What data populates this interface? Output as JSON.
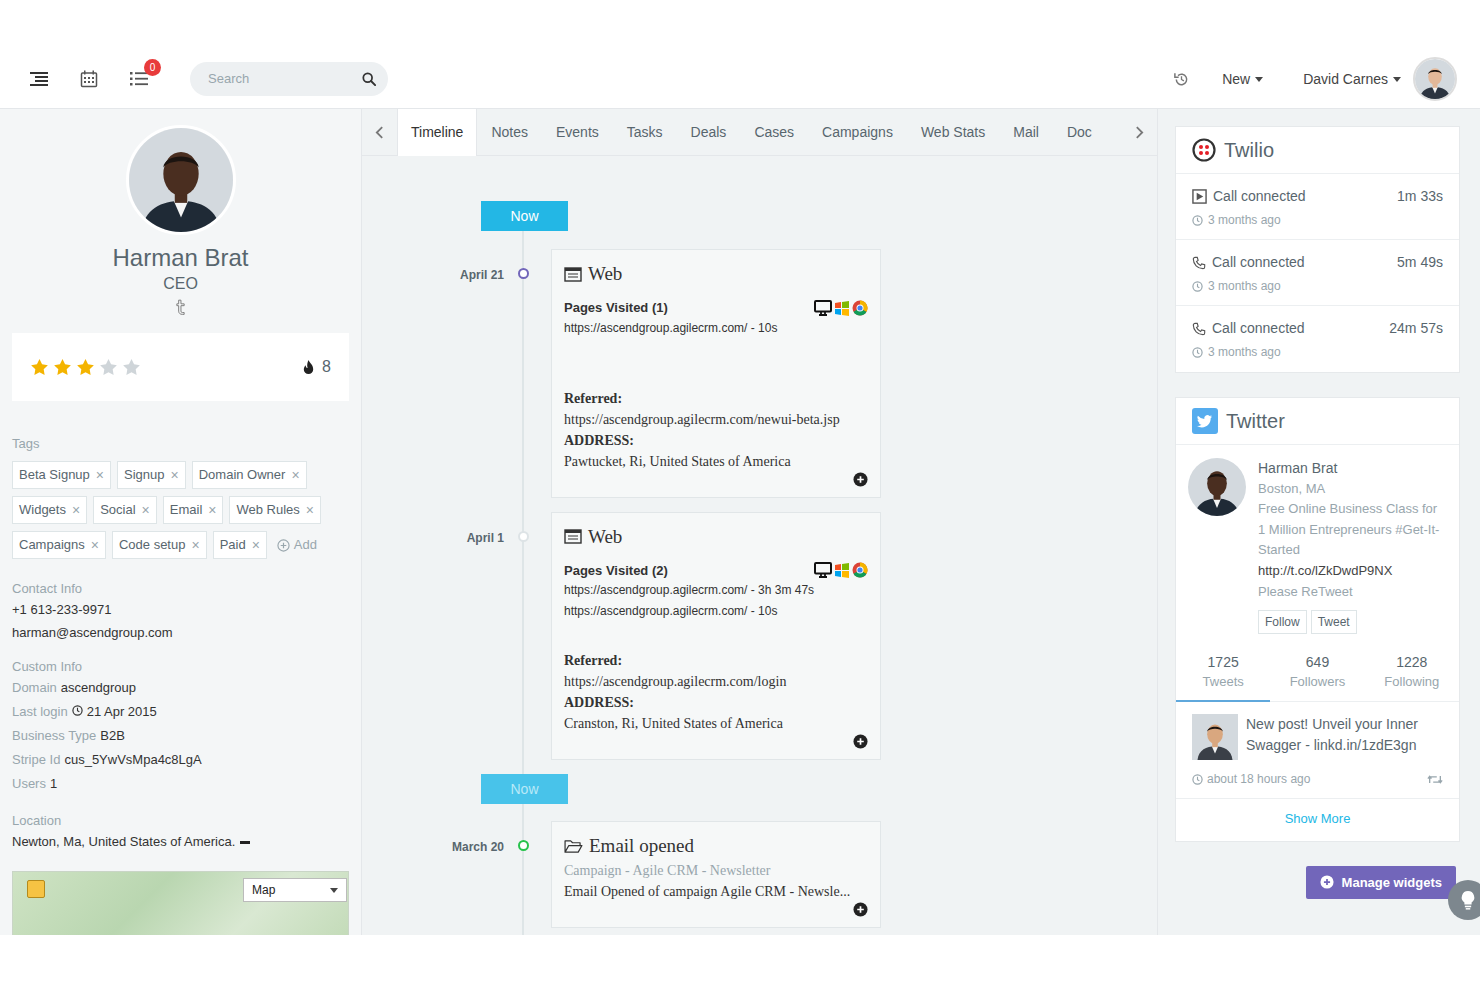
{
  "header": {
    "badge": "0",
    "search_placeholder": "Search",
    "new_label": "New",
    "user_name": "David Carnes"
  },
  "contact": {
    "name": "Harman Brat",
    "title": "CEO",
    "stars": 3,
    "score": "8",
    "tags_label": "Tags",
    "tags": [
      "Beta Signup",
      "Signup",
      "Domain Owner",
      "Widgets",
      "Social",
      "Email",
      "Web Rules",
      "Campaigns",
      "Code setup",
      "Paid"
    ],
    "tag_remove": "×",
    "add_label": "Add",
    "contact_info_label": "Contact Info",
    "phone": "+1 613-233-9971",
    "email": "harman@ascendgroup.com",
    "custom_info_label": "Custom Info",
    "custom_fields": [
      {
        "label": "Domain",
        "value": "ascendgroup",
        "kind": "text"
      },
      {
        "label": "Last login",
        "value": "21 Apr 2015",
        "kind": "time"
      },
      {
        "label": "Business Type",
        "value": "B2B",
        "kind": "text"
      },
      {
        "label": "Stripe Id",
        "value": "cus_5YwVsMpa4c8LgA",
        "kind": "text"
      },
      {
        "label": "Users",
        "value": "1",
        "kind": "text"
      }
    ],
    "location_label": "Location",
    "location": "Newton, Ma, United States of America.",
    "map_type": "Map"
  },
  "tabs": [
    {
      "label": "Timeline",
      "selected": true
    },
    {
      "label": "Notes",
      "selected": false
    },
    {
      "label": "Events",
      "selected": false
    },
    {
      "label": "Tasks",
      "selected": false
    },
    {
      "label": "Deals",
      "selected": false
    },
    {
      "label": "Cases",
      "selected": false
    },
    {
      "label": "Campaigns",
      "selected": false
    },
    {
      "label": "Web Stats",
      "selected": false
    },
    {
      "label": "Mail",
      "selected": false
    },
    {
      "label": "Doc",
      "selected": false
    }
  ],
  "timeline": {
    "items": [
      {
        "kind": "now",
        "label": "Now",
        "dim": false
      },
      {
        "kind": "web",
        "date": "April 21",
        "color": "#7266ba",
        "title": "Web",
        "pages_label": "Pages Visited (1)",
        "pages": [
          "https://ascendgroup.agilecrm.com/ - 10s"
        ],
        "referred_label": "Referred:",
        "referred": "https://ascendgroup.agilecrm.com/newui-beta.jsp",
        "address_label": "ADDRESS:",
        "address": "Pawtucket, Ri, United States of America"
      },
      {
        "kind": "web",
        "date": "April 1",
        "color": "#dde3e6",
        "title": "Web",
        "pages_label": "Pages Visited (2)",
        "pages": [
          "https://ascendgroup.agilecrm.com/ - 3h 3m 47s",
          "https://ascendgroup.agilecrm.com/ - 10s"
        ],
        "referred_label": "Referred:",
        "referred": "https://ascendgroup.agilecrm.com/login",
        "address_label": "ADDRESS:",
        "address": "Cranston, Ri, United States of America"
      },
      {
        "kind": "now",
        "label": "Now",
        "dim": true
      },
      {
        "kind": "email",
        "date": "March 20",
        "color": "#27c24c",
        "title": "Email opened",
        "campaign": "Campaign - Agile CRM - Newsletter",
        "text": "Email Opened of campaign Agile CRM - Newsle..."
      }
    ]
  },
  "twilio": {
    "title": "Twilio",
    "calls": [
      {
        "kind": "outgoing",
        "label": "Call connected",
        "duration": "1m 33s",
        "ago": "3 months ago"
      },
      {
        "kind": "phone",
        "label": "Call connected",
        "duration": "5m 49s",
        "ago": "3 months ago"
      },
      {
        "kind": "phone",
        "label": "Call connected",
        "duration": "24m 57s",
        "ago": "3 months ago"
      }
    ]
  },
  "twitter": {
    "title": "Twitter",
    "name": "Harman Brat",
    "location": "Boston, MA",
    "bio": "Free Online Business Class for 1 Million Entrepreneurs #Get-It-Started",
    "link": "http://t.co/lZkDwdP9NX",
    "bio_end": "Please ReTweet",
    "follow": "Follow",
    "tweet": "Tweet",
    "stats": [
      {
        "value": "1725",
        "label": "Tweets",
        "selected": true
      },
      {
        "value": "649",
        "label": "Followers",
        "selected": false
      },
      {
        "value": "1228",
        "label": "Following",
        "selected": false
      }
    ],
    "post": {
      "text": "New post! Unveil your Inner Swagger - linkd.in/1zdE3gn",
      "ago": "about 18 hours ago"
    },
    "show_more": "Show More"
  },
  "manage_widgets": "Manage widgets"
}
